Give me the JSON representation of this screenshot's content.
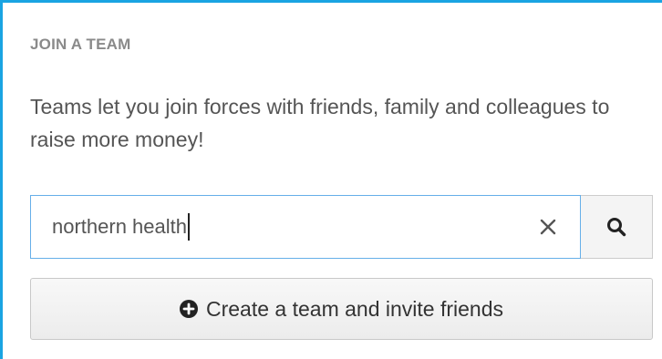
{
  "team": {
    "heading": "JOIN A TEAM",
    "description": "Teams let you join forces with friends, family and colleagues to raise more money!",
    "search": {
      "value": "northern health",
      "clear_icon": "close-icon",
      "search_icon": "search-icon"
    },
    "create_button": {
      "label": "Create a team and invite friends",
      "icon": "plus-circle-icon"
    }
  },
  "colors": {
    "accent": "#1aa4e2",
    "focus_border": "#66afe9",
    "heading": "#8a8a8a",
    "text": "#555555"
  }
}
